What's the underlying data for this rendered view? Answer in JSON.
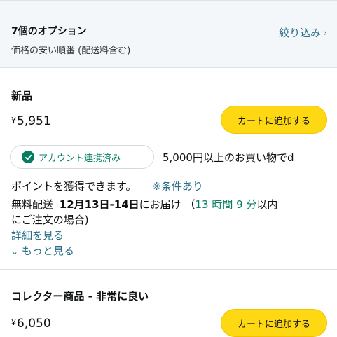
{
  "header": {
    "title": "7個のオプション",
    "subtitle": "価格の安い順番 (配送料含む)",
    "filter_label": "絞り込み",
    "filter_chevron": "›"
  },
  "offers": [
    {
      "condition": "新品",
      "currency": "¥",
      "price": "5,951",
      "cart_label": "カートに追加する",
      "badge_label": "アカウント連携済み",
      "promo_line1": "5,000円以上のお買い物でd",
      "promo_line2": "ポイントを獲得できます。",
      "conditions_link": "※条件あり",
      "delivery_prefix": "無料配送",
      "delivery_dates": "12月13日-14日",
      "delivery_suffix": "にお届け",
      "countdown_open": "（",
      "countdown": "13 時間 9 分",
      "countdown_suffix": "以内",
      "order_note": "にご注文の場合)",
      "details_link": "詳細を見る",
      "see_more_chevron": "⌄",
      "see_more": "もっと見る"
    },
    {
      "condition": "コレクター商品 - 非常に良い",
      "currency": "¥",
      "price": "6,050",
      "cart_label": "カートに追加する"
    }
  ]
}
